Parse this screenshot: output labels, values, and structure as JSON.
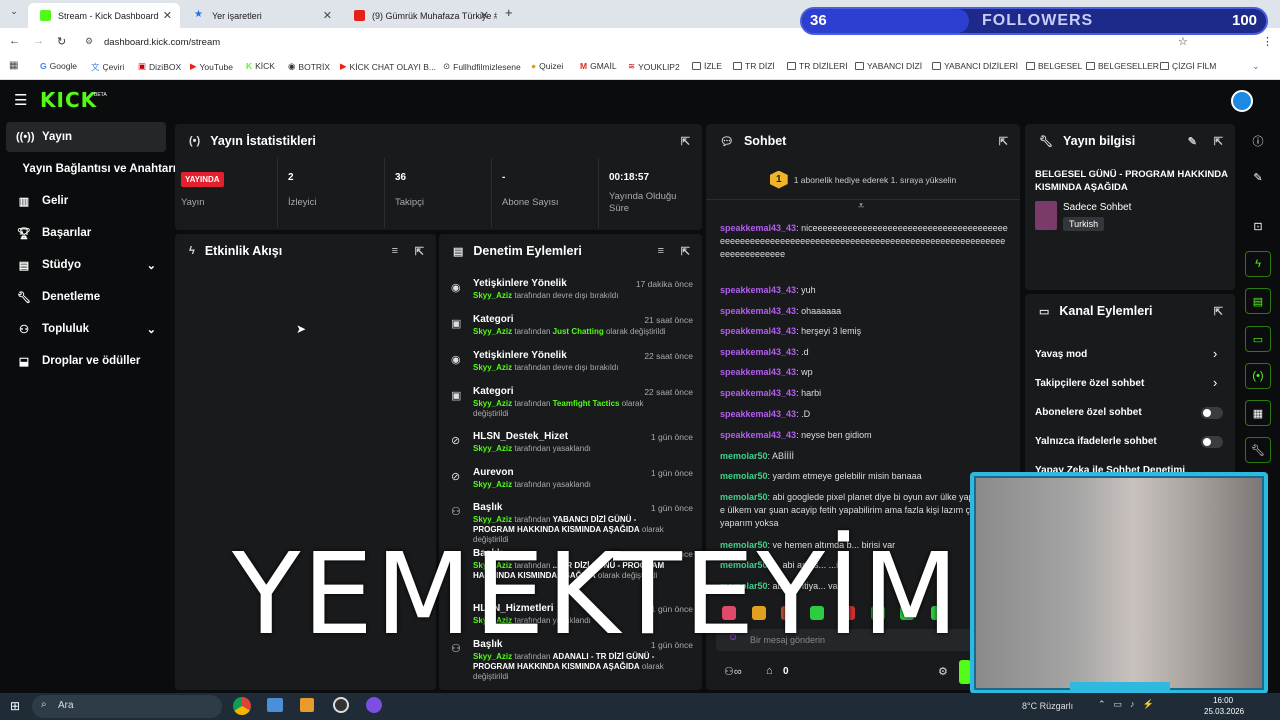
{
  "browser": {
    "tabs": [
      {
        "title": "Stream - Kick Dashboard",
        "active": true
      },
      {
        "title": "Yer işaretleri",
        "active": false
      },
      {
        "title": "(9) Gümrük Muhafaza Türkiye #",
        "active": false
      }
    ],
    "url": "dashboard.kick.com/stream",
    "bookmarks": [
      "Google",
      "Çeviri",
      "DiziBOX",
      "YouTube",
      "KİCK",
      "BOTRİX",
      "KİCK CHAT OLAYI B...",
      "Fullhdfilmizlesene",
      "Quizei",
      "GMAİL",
      "YOUKLIP2",
      "İZLE",
      "TR DİZİ",
      "TR DİZİLERİ",
      "YABANCI DİZİ",
      "YABANCI DİZİLERİ",
      "BELGESEL",
      "BELGESELLER",
      "ÇİZGİ FİLM"
    ]
  },
  "overlay_followers": {
    "count": "36",
    "label": "FOLLOWERS",
    "goal": "100",
    "progress": 0.36
  },
  "app": {
    "logo": "KICK",
    "logo_tag": "BETA"
  },
  "sidebar": {
    "items": [
      {
        "label": "Yayın",
        "icon": "broadcast-icon",
        "active": true
      },
      {
        "label": "Yayın Bağlantısı ve Anahtarı",
        "icon": ""
      },
      {
        "label": "Gelir",
        "icon": "revenue-icon"
      },
      {
        "label": "Başarılar",
        "icon": "trophy-icon"
      },
      {
        "label": "Stüdyo",
        "icon": "studio-icon"
      },
      {
        "label": "Denetleme",
        "icon": "wrench-icon"
      },
      {
        "label": "Topluluk",
        "icon": "community-icon"
      },
      {
        "label": "Droplar ve ödüller",
        "icon": "drops-icon"
      }
    ]
  },
  "stats": {
    "title": "Yayın İstatistikleri",
    "live_badge": "YAYINDA",
    "live_label": "Yayın",
    "viewers_value": "2",
    "viewers_label": "İzleyici",
    "followers_value": "36",
    "followers_label": "Takipçi",
    "subs_value": "-",
    "subs_label": "Abone Sayısı",
    "uptime_value": "00:18:57",
    "uptime_label": "Yayında Olduğu Süre"
  },
  "activity": {
    "title": "Etkinlik Akışı"
  },
  "moderation": {
    "title": "Denetim Eylemleri",
    "items": [
      {
        "title": "Yetişkinlere Yönelik",
        "time": "17 dakika önce",
        "user": "Skyy_Aziz",
        "pre": "tarafından devre dışı bırakıldı",
        "hl": "",
        "post": ""
      },
      {
        "title": "Kategori",
        "time": "21 saat önce",
        "user": "Skyy_Aziz",
        "pre": "tarafından",
        "hl": "Just Chatting",
        "post": "olarak değiştirildi"
      },
      {
        "title": "Yetişkinlere Yönelik",
        "time": "22 saat önce",
        "user": "Skyy_Aziz",
        "pre": "tarafından devre dışı bırakıldı",
        "hl": "",
        "post": ""
      },
      {
        "title": "Kategori",
        "time": "22 saat önce",
        "user": "Skyy_Aziz",
        "pre": "tarafından",
        "hl": "Teamfight Tactics",
        "post": "olarak değiştirildi"
      },
      {
        "title": "HLSN_Destek_Hizet",
        "time": "1 gün önce",
        "user": "Skyy_Aziz",
        "pre": "tarafından yasaklandı",
        "hl": "",
        "post": ""
      },
      {
        "title": "Aurevon",
        "time": "1 gün önce",
        "user": "Skyy_Aziz",
        "pre": "tarafından yasaklandı",
        "hl": "",
        "post": ""
      },
      {
        "title": "Başlık",
        "time": "1 gün önce",
        "user": "Skyy_Aziz",
        "pre": "tarafından",
        "hl": "YABANCI DİZİ GÜNÜ - PROGRAM HAKKINDA KISMINDA AŞAĞIDA",
        "post": "olarak değiştirildi"
      },
      {
        "title": "Başlık",
        "time": "1 gün önce",
        "user": "Skyy_Aziz",
        "pre": "tarafından",
        "hl": "... TR DİZİ GÜNÜ - PROGRAM HAKKINDA KISMINDA AŞAĞIDA",
        "post": "olarak değiştirildi"
      },
      {
        "title": "HLSN_Hizmetleri",
        "time": "1 gün önce",
        "user": "Skyy_Aziz",
        "pre": "tarafından yasaklandı",
        "hl": "",
        "post": ""
      },
      {
        "title": "Başlık",
        "time": "1 gün önce",
        "user": "Skyy_Aziz",
        "pre": "tarafından",
        "hl": "ADANALI - TR DİZİ GÜNÜ - PROGRAM HAKKINDA KISMINDA AŞAĞIDA",
        "post": "olarak değiştirildi"
      }
    ]
  },
  "chat": {
    "title": "Sohbet",
    "promo_rank": "1",
    "promo": "1 abonelik hediye ederek 1. sıraya yükselin",
    "messages": [
      {
        "user": "speakkemal43_43",
        "text": "niceeeeeeeeeeeeeeeeeeeeeeeeeeeeeeeeeeeeeeeeeeeeeeeeeeeeeeeeeeeeeeeeeeeeeeeeeeeeeeeeeeeeeeeeeeeeeeeeeeeeeeeeeeeee",
        "c": "u1"
      },
      {
        "user": "speakkemal43_43",
        "text": "yuh",
        "c": "u1"
      },
      {
        "user": "speakkemal43_43",
        "text": "ohaaaaaa",
        "c": "u1"
      },
      {
        "user": "speakkemal43_43",
        "text": "herşeyi 3 lemiş",
        "c": "u1"
      },
      {
        "user": "speakkemal43_43",
        "text": ".d",
        "c": "u1"
      },
      {
        "user": "speakkemal43_43",
        "text": "wp",
        "c": "u1"
      },
      {
        "user": "speakkemal43_43",
        "text": "harbi",
        "c": "u1"
      },
      {
        "user": "speakkemal43_43",
        "text": ".D",
        "c": "u1"
      },
      {
        "user": "speakkemal43_43",
        "text": "neyse ben gidiom",
        "c": "u1"
      },
      {
        "user": "memolar50",
        "text": "ABİİİİ",
        "c": "u2"
      },
      {
        "user": "memolar50",
        "text": "yardım etmeye gelebilir misin banaaa",
        "c": "u2"
      },
      {
        "user": "memolar50",
        "text": "abi googlede pixel planet diye bi oyun avr ülke yap benim de ülkem var şuan acayip fetih yapabilirim ama fazla kişi lazım çok yavaş yaparım yoksa",
        "c": "u2"
      },
      {
        "user": "memolar50",
        "text": "ve hemen altımda b... birisi var",
        "c": "u2"
      },
      {
        "user": "memolar50",
        "text": "... abi ark is... ...iyo",
        "c": "u2"
      },
      {
        "user": "memolar50",
        "text": "abi ... ihtiya... var",
        "c": "u2"
      }
    ],
    "input_placeholder": "Bir mesaj gönderin",
    "viewers_count": "0"
  },
  "stream_info": {
    "title": "Yayın bilgisi",
    "stream_title": "BELGESEL GÜNÜ - PROGRAM HAKKINDA KISMINDA AŞAĞIDA",
    "category": "Sadece Sohbet",
    "language": "Turkish"
  },
  "channel_actions": {
    "title": "Kanal Eylemleri",
    "items": [
      {
        "label": "Yavaş mod",
        "kind": "chevron"
      },
      {
        "label": "Takipçilere özel sohbet",
        "kind": "chevron"
      },
      {
        "label": "Abonelere özel sohbet",
        "kind": "toggle"
      },
      {
        "label": "Yalnızca ifadelerle sohbet",
        "kind": "toggle"
      },
      {
        "label": "Yapay Zeka ile Sohbet Denetimi",
        "kind": "toggle"
      }
    ]
  },
  "overlay_text": "YEMEKTEYİM",
  "taskbar": {
    "search": "Ara",
    "weather": "8°C Rüzgarlı",
    "time": "16:00",
    "date": "25.03.2026"
  },
  "colors": {
    "kick_green": "#53fc18",
    "live_red": "#e5202e",
    "panel": "#181a1c",
    "page": "#0b0c0d"
  }
}
